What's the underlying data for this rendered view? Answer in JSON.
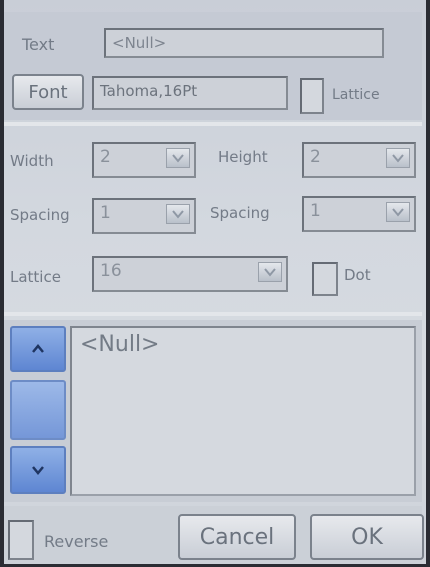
{
  "text_row": {
    "label": "Text",
    "value": "<Null>"
  },
  "font_row": {
    "button_label": "Font",
    "value": "Tahoma,16Pt",
    "lattice_label": "Lattice",
    "lattice_checked": false
  },
  "size": {
    "width_label": "Width",
    "width_value": "2",
    "height_label": "Height",
    "height_value": "2"
  },
  "spacing": {
    "left_label": "Spacing",
    "left_value": "1",
    "right_label": "Spacing",
    "right_value": "1"
  },
  "lattice": {
    "label": "Lattice",
    "value": "16",
    "dot_label": "Dot",
    "dot_checked": false
  },
  "memo": {
    "value": "<Null>"
  },
  "bottom": {
    "reverse_label": "Reverse",
    "reverse_checked": false,
    "cancel_label": "Cancel",
    "ok_label": "OK"
  },
  "icons": {
    "scroll_up": "chevron-up-icon",
    "scroll_down": "chevron-down-icon",
    "combo_arrow": "chevron-down-icon"
  },
  "colors": {
    "accent": "#6f95da",
    "background": "#d3d8df"
  }
}
